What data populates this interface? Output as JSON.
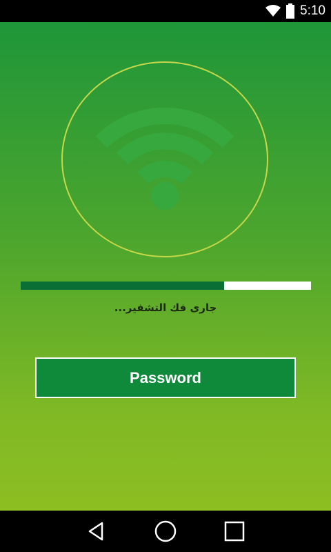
{
  "status_bar": {
    "time": "5:10",
    "icons": [
      "wifi-icon",
      "battery-icon"
    ]
  },
  "main": {
    "progress": 0.7,
    "status_text": "جارى فك التشفير...",
    "password_button_label": "Password"
  },
  "nav": {
    "icons": [
      "back-icon",
      "home-icon",
      "recents-icon"
    ]
  },
  "colors": {
    "gradient_top": "#1f9639",
    "gradient_bottom": "#8dbe22",
    "button": "#0f8a3a",
    "progress_fill": "#0a6f35",
    "circle_outline": "#c6d84a"
  }
}
